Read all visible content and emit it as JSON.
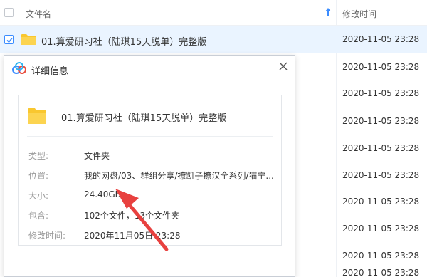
{
  "list": {
    "header": {
      "name_label": "文件名",
      "time_label": "修改时间"
    },
    "rows": [
      {
        "name": "01.算爱研习社（陆琪15天脱单）完整版",
        "time": "2020-11-05 23:28",
        "selected": true
      },
      {
        "name": "",
        "time": "2020-11-05 23:28"
      },
      {
        "name": "",
        "time": "2020-11-05 23:28"
      },
      {
        "name": "",
        "time": "2020-11-05 23:28"
      },
      {
        "name": "",
        "time": "2020-11-05 23:28"
      },
      {
        "name": "",
        "time": "2020-11-05 23:28"
      },
      {
        "name": "",
        "time": "2020-11-05 23:28"
      },
      {
        "name": "",
        "time": "2020-11-05 23:28"
      },
      {
        "name": "",
        "time": "2020-11-05 23:28"
      },
      {
        "name": "",
        "time": "2020-11-05 23:28"
      }
    ]
  },
  "dialog": {
    "title": "详细信息",
    "file_name": "01.算爱研习社（陆琪15天脱单）完整版",
    "props": {
      "type_label": "类型:",
      "type_value": "文件夹",
      "location_label": "位置:",
      "location_value": "我的网盘/03、群组分享/撩凯子撩汉全系列/猫宁...",
      "size_label": "大小:",
      "size_value": "24.40GB",
      "contains_label": "包含:",
      "contains_value": "102个文件，13个文件夹",
      "modified_label": "修改时间:",
      "modified_value": "2020年11月05日  23:28"
    }
  },
  "colors": {
    "accent": "#3b8cff",
    "folder": "#f9c72f",
    "selected_row": "#eaf4ff",
    "annotation_arrow": "#e8413f"
  }
}
